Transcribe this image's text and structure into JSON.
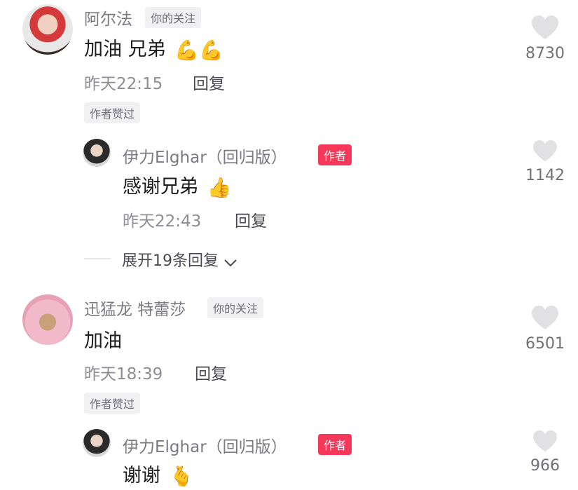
{
  "comments": [
    {
      "name": "阿尔法",
      "follow_tag": "你的关注",
      "text": "加油 兄弟",
      "emoji": "💪💪",
      "time": "昨天22:15",
      "reply_label": "回复",
      "liked_by_author": "作者赞过",
      "likes": "8730",
      "reply": {
        "name": "伊力Elghar（回归版）",
        "author_tag": "作者",
        "text": "感谢兄弟",
        "emoji": "👍",
        "time": "昨天22:43",
        "reply_label": "回复",
        "likes": "1142"
      },
      "expand_label": "展开19条回复"
    },
    {
      "name": "迅猛龙 特蕾莎",
      "follow_tag": "你的关注",
      "text": "加油",
      "time": "昨天18:39",
      "reply_label": "回复",
      "liked_by_author": "作者赞过",
      "likes": "6501",
      "reply": {
        "name": "伊力Elghar（回归版）",
        "author_tag": "作者",
        "text": "谢谢",
        "emoji": "🫰",
        "likes": "966"
      }
    }
  ],
  "colors": {
    "author_tag": "#f5375a",
    "heart": "#e1e1e4"
  },
  "icons": {
    "like": "heart-icon",
    "expand": "chevron-down-icon"
  }
}
